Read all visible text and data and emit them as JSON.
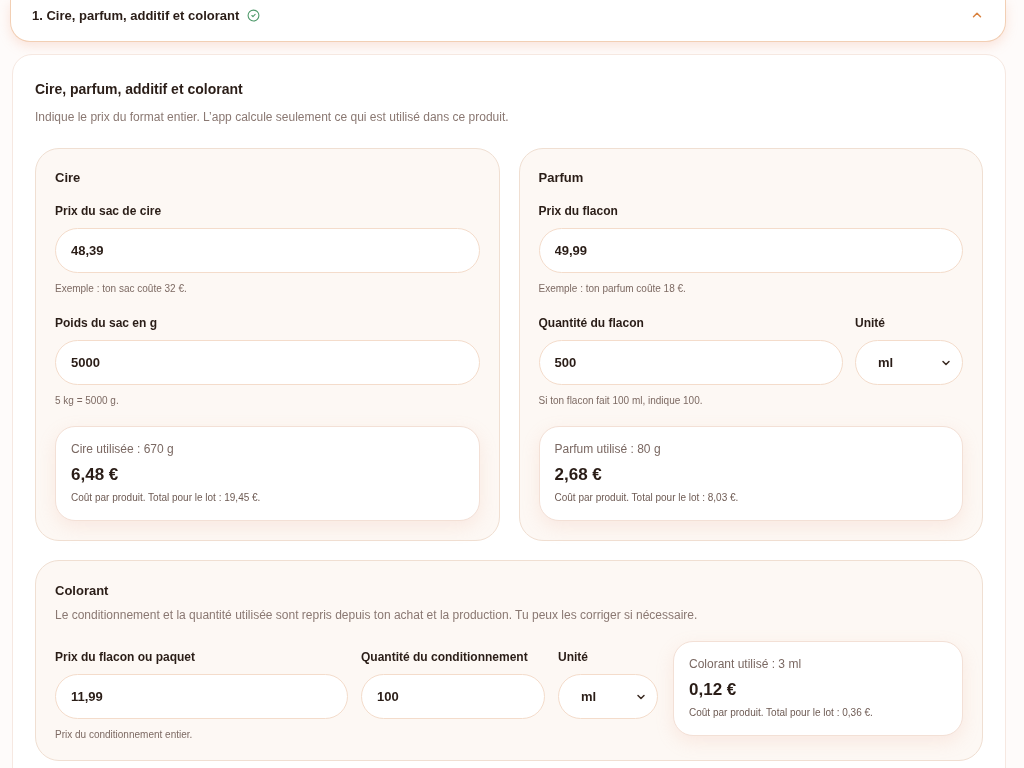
{
  "accordion": {
    "title": "1. Cire, parfum, additif et colorant",
    "complete": true,
    "expanded": true
  },
  "section": {
    "title": "Cire, parfum, additif et colorant",
    "description": "Indique le prix du format entier. L’app calcule seulement ce qui est utilisé dans ce produit."
  },
  "cards": [
    {
      "kind": "stacked",
      "title": "Cire",
      "rows": [
        {
          "fields": [
            {
              "kind": "input",
              "label": "Prix du sac de cire",
              "value": "48,39",
              "hint": "Exemple : ton sac coûte 32 €."
            }
          ]
        },
        {
          "fields": [
            {
              "kind": "input",
              "label": "Poids du sac en g",
              "value": "5000",
              "hint": "5 kg = 5000 g."
            }
          ]
        }
      ],
      "result": {
        "used": "Cire utilisée : 670 g",
        "cost": "6,48 €",
        "note": "Coût par produit. Total pour le lot : 19,45 €."
      }
    },
    {
      "kind": "stacked",
      "title": "Parfum",
      "rows": [
        {
          "fields": [
            {
              "kind": "input",
              "label": "Prix du flacon",
              "value": "49,99",
              "hint": "Exemple : ton parfum coûte 18 €."
            }
          ]
        },
        {
          "fields": [
            {
              "kind": "input",
              "label": "Quantité du flacon",
              "value": "500",
              "hint": "Si ton flacon fait 100 ml, indique 100."
            },
            {
              "kind": "select",
              "label": "Unité",
              "value": "ml"
            }
          ]
        }
      ],
      "result": {
        "used": "Parfum utilisé : 80 g",
        "cost": "2,68 €",
        "note": "Coût par produit. Total pour le lot : 8,03 €."
      }
    },
    {
      "kind": "inline",
      "title": "Colorant",
      "description": "Le conditionnement et la quantité utilisée sont repris depuis ton achat et la production. Tu peux les corriger si nécessaire.",
      "rows": [
        {
          "fields": [
            {
              "kind": "input",
              "label": "Prix du flacon ou paquet",
              "value": "11,99",
              "hint": "Prix du conditionnement entier."
            },
            {
              "kind": "input",
              "label": "Quantité du conditionnement",
              "value": "100"
            },
            {
              "kind": "select",
              "label": "Unité",
              "value": "ml"
            }
          ]
        }
      ],
      "result": {
        "used": "Colorant utilisé : 3 ml",
        "cost": "0,12 €",
        "note": "Coût par produit. Total pour le lot : 0,36 €."
      }
    }
  ]
}
